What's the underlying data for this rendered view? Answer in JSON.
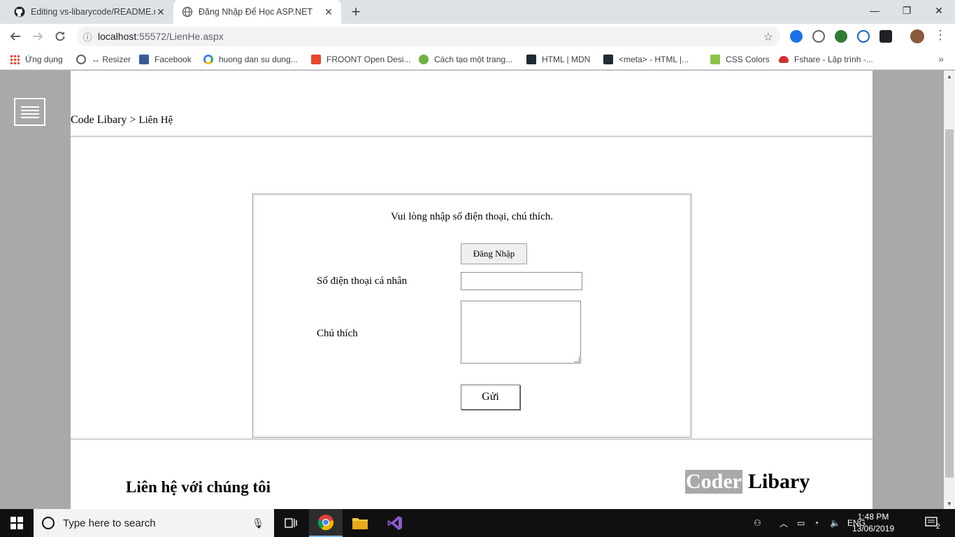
{
  "browser": {
    "tabs": [
      {
        "title": "Editing vs-libarycode/README.m",
        "active": false,
        "favicon": "github-icon"
      },
      {
        "title": "Đăng Nhập Để Học ASP.NET",
        "active": true,
        "favicon": "globe-icon"
      }
    ],
    "url_host": "localhost",
    "url_rest": ":55572/LienHe.aspx",
    "bookmarks": [
      {
        "label": "Ứng dụng",
        "icon": "apps-grid-icon"
      },
      {
        "label": "↔ Resizer",
        "icon": "globe-icon"
      },
      {
        "label": "Facebook",
        "icon": "facebook-icon"
      },
      {
        "label": "huong dan su dung...",
        "icon": "google-icon"
      },
      {
        "label": "FROONT Open Desi...",
        "icon": "froont-icon"
      },
      {
        "label": "Cách tạo một trang...",
        "icon": "wordpress-icon"
      },
      {
        "label": "HTML | MDN",
        "icon": "mdn-icon"
      },
      {
        "label": "<meta> - HTML |...",
        "icon": "mdn-icon"
      },
      {
        "label": "CSS Colors",
        "icon": "w3c-icon"
      },
      {
        "label": "Fshare - Lập trình -...",
        "icon": "cloud-icon"
      }
    ]
  },
  "page": {
    "breadcrumb_root": "Code Libary",
    "breadcrumb_sep": " > ",
    "breadcrumb_current": "Liên Hệ",
    "form": {
      "prompt": "Vui lòng nhập số điện thoại, chú thích.",
      "login_button": "Đăng Nhập",
      "phone_label": "Số điện thoại cá nhân",
      "phone_value": "",
      "note_label": "Chú thích",
      "note_value": "",
      "send_button": "Gửi"
    },
    "footer": {
      "contact_title": "Liên hệ với chúng tôi",
      "logo_part1": "Coder",
      "logo_part2": "Libary"
    }
  },
  "taskbar": {
    "search_placeholder": "Type here to search",
    "language": "ENG",
    "time": "1:48 PM",
    "date": "13/06/2019",
    "notification_count": "2"
  },
  "colors": {
    "page_background": "#a9a9a9",
    "content_background": "#ffffff",
    "logo_highlight": "#a9a9a9"
  }
}
